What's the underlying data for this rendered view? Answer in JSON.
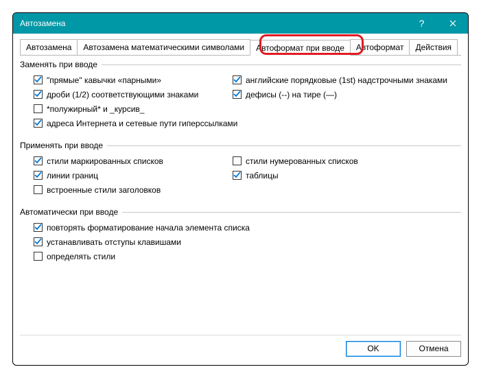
{
  "titlebar": {
    "title": "Автозамена"
  },
  "tabs": {
    "t0": "Автозамена",
    "t1": "Автозамена математическими символами",
    "t2": "Автоформат при вводе",
    "t3": "Автоформат",
    "t4": "Действия"
  },
  "groups": {
    "replace": {
      "title": "Заменять при вводе",
      "items": {
        "quotes": "\"прямые\" кавычки «парными»",
        "fractions": "дроби (1/2) соответствующими знаками",
        "bold_italic": "*полужирный* и _курсив_",
        "internet": "адреса Интернета и сетевые пути гиперссылками",
        "ordinals": "английские порядковые (1st) надстрочными знаками",
        "hyphens": "дефисы (--) на тире (—)"
      }
    },
    "apply": {
      "title": "Применять при вводе",
      "items": {
        "bullets": "стили маркированных списков",
        "borders": "линии границ",
        "headings": "встроенные стили заголовков",
        "numbered": "стили нумерованных списков",
        "tables": "таблицы"
      }
    },
    "auto": {
      "title": "Автоматически при вводе",
      "items": {
        "repeat_format": "повторять форматирование начала элемента списка",
        "tab_indent": "устанавливать отступы клавишами",
        "define_styles": "определять стили"
      }
    }
  },
  "buttons": {
    "ok": "OK",
    "cancel": "Отмена"
  }
}
